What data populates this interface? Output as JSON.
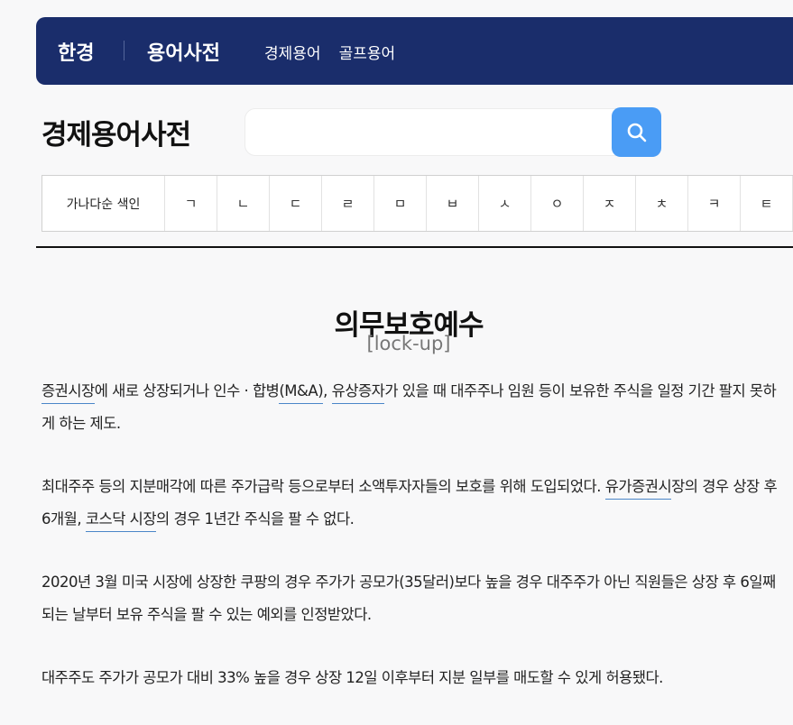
{
  "header": {
    "logo": "한경",
    "site_title": "용어사전",
    "nav": [
      {
        "label": "경제용어"
      },
      {
        "label": "골프용어"
      }
    ]
  },
  "dictionary": {
    "title": "경제용어사전",
    "search_placeholder": "",
    "search_icon": "search-icon"
  },
  "index": {
    "label": "가나다순 색인",
    "letters": [
      "ㄱ",
      "ㄴ",
      "ㄷ",
      "ㄹ",
      "ㅁ",
      "ㅂ",
      "ㅅ",
      "ㅇ",
      "ㅈ",
      "ㅊ",
      "ㅋ",
      "ㅌ"
    ]
  },
  "term": {
    "title": "의무보호예수",
    "english": "[lock-up]",
    "p1": {
      "link1": "증권시장",
      "t1": "에 새로 상장되거나 인수 · 합병",
      "link2": "(M&A)",
      "t2": ", ",
      "link3": "유상증자",
      "t3": "가 있을 때 대주주나 임원 등이 보유한 주식을 일정 기간 팔지 못하게 하는 제도."
    },
    "p2": {
      "t1": "최대주주 등의 지분매각에 따른 주가급락 등으로부터 소액투자자들의 보호를 위해 도입되었다. ",
      "link1": "유가증권시",
      "t2": "장의 경우 상장 후 6개월, ",
      "link2": "코스닥 시장",
      "t3": "의 경우 1년간 주식을 팔 수 없다."
    },
    "p3": "2020년 3월 미국 시장에 상장한 쿠팡의 경우 주가가 공모가(35달러)보다 높을 경우 대주주가 아닌 직원들은 상장 후 6일째 되는 날부터 보유 주식을 팔 수 있는 예외를 인정받았다.",
    "p4": "대주주도 주가가 공모가 대비 33% 높을 경우 상장 12일 이후부터 지분 일부를 매도할 수 있게 허용됐다."
  },
  "colors": {
    "header_bg": "#1a2d6b",
    "search_button": "#4a9cf5",
    "link_underline": "#4a86c8"
  }
}
